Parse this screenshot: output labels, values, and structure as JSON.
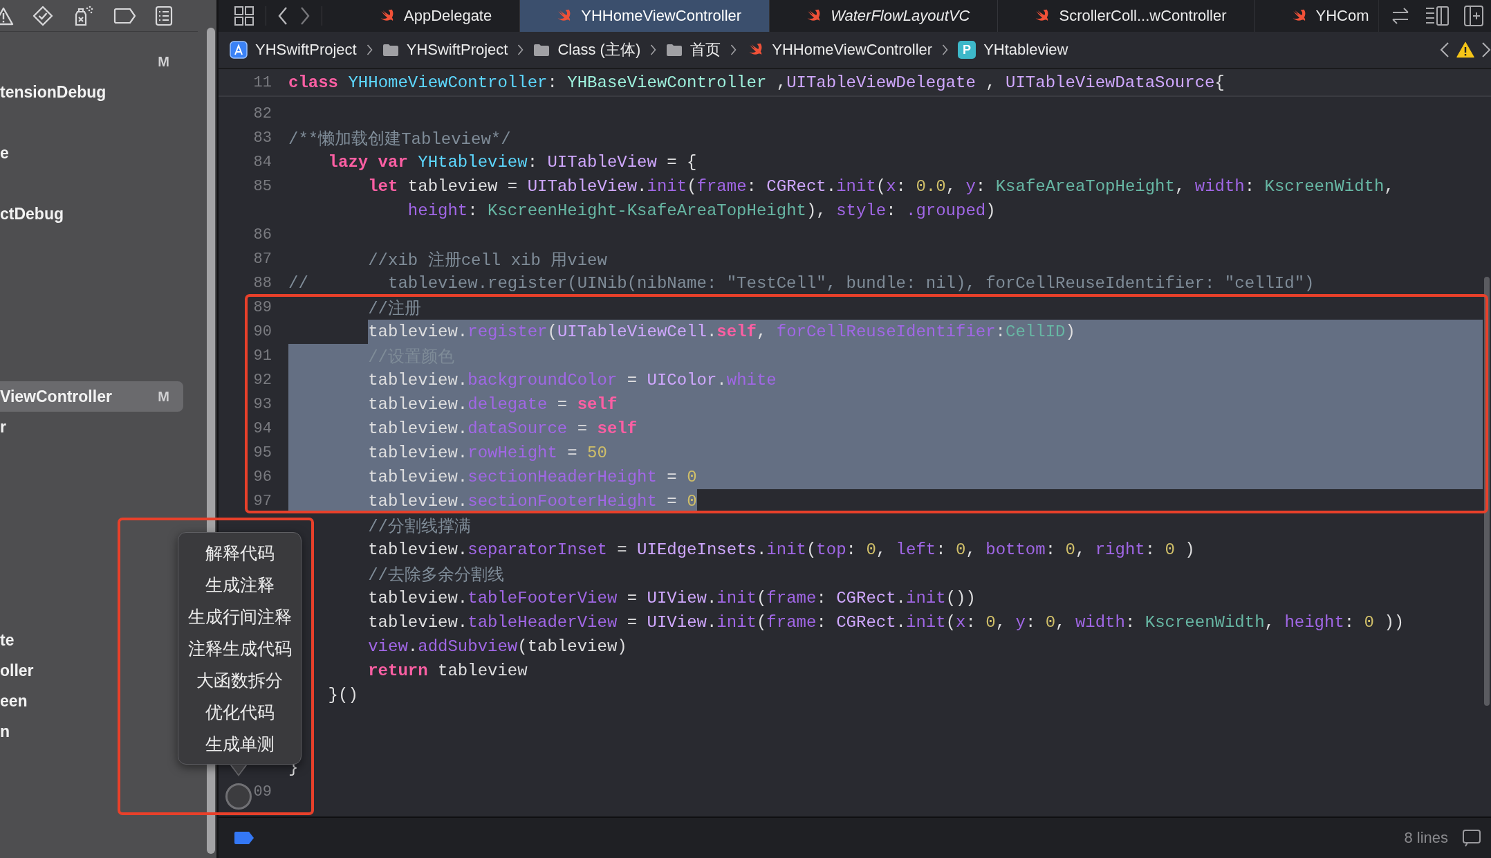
{
  "tabs": [
    {
      "label": "AppDelegate",
      "selected": false,
      "preview": false
    },
    {
      "label": "YHHomeViewController",
      "selected": true,
      "preview": false
    },
    {
      "label": "WaterFlowLayoutVC",
      "selected": false,
      "preview": true
    },
    {
      "label": "ScrollerColl...wController",
      "selected": false,
      "preview": false
    },
    {
      "label": "YHCom",
      "selected": false,
      "preview": false
    }
  ],
  "breadcrumbs": [
    {
      "kind": "project",
      "label": "YHSwiftProject"
    },
    {
      "kind": "folder",
      "label": "YHSwiftProject"
    },
    {
      "kind": "folder",
      "label": "Class (主体)"
    },
    {
      "kind": "folder",
      "label": "首页"
    },
    {
      "kind": "swift",
      "label": "YHHomeViewController"
    },
    {
      "kind": "property",
      "badge": "P",
      "label": "YHtableview"
    }
  ],
  "navigator": {
    "items": [
      {
        "badge": "M",
        "selected": false
      },
      {
        "label": "tensionDebug",
        "selected": false
      },
      {
        "label": "e",
        "selected": false
      },
      {
        "label": "ctDebug",
        "selected": false
      },
      {
        "label": "ViewController",
        "badge": "M",
        "selected": true
      },
      {
        "label": "r",
        "selected": false
      },
      {
        "label": "te",
        "selected": false
      },
      {
        "label": "oller",
        "selected": false
      },
      {
        "label": "een",
        "selected": false
      },
      {
        "label": "n",
        "selected": false
      }
    ]
  },
  "editor": {
    "sticky_line": {
      "number": "11",
      "tokens": [
        {
          "kind": "keyword",
          "text": "class"
        },
        {
          "kind": "decl",
          "text": " YHHomeViewController"
        },
        {
          "kind": "plain",
          "text": ": "
        },
        {
          "kind": "project",
          "text": "YHBaseViewController"
        },
        {
          "kind": "plain",
          "text": " ,"
        },
        {
          "kind": "type",
          "text": "UITableViewDelegate"
        },
        {
          "kind": "plain",
          "text": " , "
        },
        {
          "kind": "type",
          "text": "UITableViewDataSource"
        },
        {
          "kind": "plain",
          "text": "{"
        }
      ]
    },
    "lines": [
      {
        "number": "82",
        "selected": false
      },
      {
        "number": "83",
        "selected": false,
        "rows": [
          {
            "tokens": [
              {
                "kind": "comment",
                "text": "/**懒加载创建Tableview*/"
              }
            ]
          }
        ]
      },
      {
        "number": "84",
        "selected": false,
        "rows": [
          {
            "tokens": [
              {
                "kind": "keyword",
                "text": "    lazy"
              },
              {
                "kind": "keyword",
                "text": " var"
              },
              {
                "kind": "decl",
                "text": " YHtableview"
              },
              {
                "kind": "plain",
                "text": ": "
              },
              {
                "kind": "type",
                "text": "UITableView"
              },
              {
                "kind": "plain",
                "text": " = {"
              }
            ]
          }
        ]
      },
      {
        "number": "85",
        "selected": false,
        "rows": [
          {
            "tokens": [
              {
                "kind": "keyword",
                "text": "        let"
              },
              {
                "kind": "plain",
                "text": " tableview = "
              },
              {
                "kind": "type",
                "text": "UITableView"
              },
              {
                "kind": "plain",
                "text": "."
              },
              {
                "kind": "member",
                "text": "init"
              },
              {
                "kind": "plain",
                "text": "("
              },
              {
                "kind": "member",
                "text": "frame"
              },
              {
                "kind": "plain",
                "text": ": "
              },
              {
                "kind": "type",
                "text": "CGRect"
              },
              {
                "kind": "plain",
                "text": "."
              },
              {
                "kind": "member",
                "text": "init"
              },
              {
                "kind": "plain",
                "text": "("
              },
              {
                "kind": "member",
                "text": "x"
              },
              {
                "kind": "plain",
                "text": ": "
              },
              {
                "kind": "number",
                "text": "0.0"
              },
              {
                "kind": "plain",
                "text": ", "
              },
              {
                "kind": "member",
                "text": "y"
              },
              {
                "kind": "plain",
                "text": ": "
              },
              {
                "kind": "ident",
                "text": "KsafeAreaTopHeight"
              },
              {
                "kind": "plain",
                "text": ", "
              },
              {
                "kind": "member",
                "text": "width"
              },
              {
                "kind": "plain",
                "text": ": "
              },
              {
                "kind": "ident",
                "text": "KscreenWidth"
              },
              {
                "kind": "plain",
                "text": ","
              }
            ]
          },
          {
            "tokens": [
              {
                "kind": "member",
                "text": "            height"
              },
              {
                "kind": "plain",
                "text": ": "
              },
              {
                "kind": "ident",
                "text": "KscreenHeight-KsafeAreaTopHeight"
              },
              {
                "kind": "plain",
                "text": "), "
              },
              {
                "kind": "member",
                "text": "style"
              },
              {
                "kind": "plain",
                "text": ": "
              },
              {
                "kind": "member",
                "text": ".grouped"
              },
              {
                "kind": "plain",
                "text": ")"
              }
            ]
          }
        ]
      },
      {
        "number": "86",
        "selected": false
      },
      {
        "number": "87",
        "selected": false,
        "rows": [
          {
            "tokens": [
              {
                "kind": "comment",
                "text": "        //xib 注册cell xib 用view"
              }
            ]
          }
        ]
      },
      {
        "number": "88",
        "selected": false,
        "rows": [
          {
            "tokens": [
              {
                "kind": "comment",
                "text": "//        tableview.register(UINib(nibName: \"TestCell\", bundle: nil), forCellReuseIdentifier: \"cellId\")"
              }
            ]
          }
        ]
      },
      {
        "number": "89",
        "selected": false,
        "rows": [
          {
            "tokens": [
              {
                "kind": "comment",
                "text": "        //注册"
              }
            ]
          }
        ]
      },
      {
        "number": "90",
        "selected": true,
        "selection_from_text": true,
        "rows": [
          {
            "tokens": [
              {
                "kind": "plain",
                "text": "        tableview."
              },
              {
                "kind": "member",
                "text": "register"
              },
              {
                "kind": "plain",
                "text": "("
              },
              {
                "kind": "type",
                "text": "UITableViewCell"
              },
              {
                "kind": "plain",
                "text": "."
              },
              {
                "kind": "keyword",
                "text": "self"
              },
              {
                "kind": "plain",
                "text": ", "
              },
              {
                "kind": "member",
                "text": "forCellReuseIdentifier"
              },
              {
                "kind": "plain",
                "text": ":"
              },
              {
                "kind": "ident",
                "text": "CellID"
              },
              {
                "kind": "plain",
                "text": ")"
              }
            ]
          }
        ]
      },
      {
        "number": "91",
        "selected": true,
        "rows": [
          {
            "tokens": [
              {
                "kind": "comment",
                "text": "        //设置颜色"
              }
            ]
          }
        ]
      },
      {
        "number": "92",
        "selected": true,
        "rows": [
          {
            "tokens": [
              {
                "kind": "plain",
                "text": "        tableview."
              },
              {
                "kind": "member",
                "text": "backgroundColor"
              },
              {
                "kind": "plain",
                "text": " = "
              },
              {
                "kind": "type",
                "text": "UIColor"
              },
              {
                "kind": "plain",
                "text": "."
              },
              {
                "kind": "member",
                "text": "white"
              }
            ]
          }
        ]
      },
      {
        "number": "93",
        "selected": true,
        "rows": [
          {
            "tokens": [
              {
                "kind": "plain",
                "text": "        tableview."
              },
              {
                "kind": "member",
                "text": "delegate"
              },
              {
                "kind": "plain",
                "text": " = "
              },
              {
                "kind": "keyword",
                "text": "self"
              }
            ]
          }
        ]
      },
      {
        "number": "94",
        "selected": true,
        "rows": [
          {
            "tokens": [
              {
                "kind": "plain",
                "text": "        tableview."
              },
              {
                "kind": "member",
                "text": "dataSource"
              },
              {
                "kind": "plain",
                "text": " = "
              },
              {
                "kind": "keyword",
                "text": "self"
              }
            ]
          }
        ]
      },
      {
        "number": "95",
        "selected": true,
        "rows": [
          {
            "tokens": [
              {
                "kind": "plain",
                "text": "        tableview."
              },
              {
                "kind": "member",
                "text": "rowHeight"
              },
              {
                "kind": "plain",
                "text": " = "
              },
              {
                "kind": "number",
                "text": "50"
              }
            ]
          }
        ]
      },
      {
        "number": "96",
        "selected": true,
        "rows": [
          {
            "tokens": [
              {
                "kind": "plain",
                "text": "        tableview."
              },
              {
                "kind": "member",
                "text": "sectionHeaderHeight"
              },
              {
                "kind": "plain",
                "text": " = "
              },
              {
                "kind": "number",
                "text": "0"
              }
            ]
          }
        ]
      },
      {
        "number": "97",
        "selected": true,
        "selection_to_text": true,
        "rows": [
          {
            "tokens": [
              {
                "kind": "plain",
                "text": "        tableview."
              },
              {
                "kind": "member",
                "text": "sectionFooterHeight"
              },
              {
                "kind": "plain",
                "text": " = "
              },
              {
                "kind": "number",
                "text": "0"
              }
            ]
          }
        ]
      },
      {
        "selected": false,
        "rows": [
          {
            "tokens": [
              {
                "kind": "comment",
                "text": "        //分割线撑满"
              }
            ]
          }
        ]
      },
      {
        "selected": false,
        "rows": [
          {
            "tokens": [
              {
                "kind": "plain",
                "text": "        tableview."
              },
              {
                "kind": "member",
                "text": "separatorInset"
              },
              {
                "kind": "plain",
                "text": " = "
              },
              {
                "kind": "type",
                "text": "UIEdgeInsets"
              },
              {
                "kind": "plain",
                "text": "."
              },
              {
                "kind": "member",
                "text": "init"
              },
              {
                "kind": "plain",
                "text": "("
              },
              {
                "kind": "member",
                "text": "top"
              },
              {
                "kind": "plain",
                "text": ": "
              },
              {
                "kind": "number",
                "text": "0"
              },
              {
                "kind": "plain",
                "text": ", "
              },
              {
                "kind": "member",
                "text": "left"
              },
              {
                "kind": "plain",
                "text": ": "
              },
              {
                "kind": "number",
                "text": "0"
              },
              {
                "kind": "plain",
                "text": ", "
              },
              {
                "kind": "member",
                "text": "bottom"
              },
              {
                "kind": "plain",
                "text": ": "
              },
              {
                "kind": "number",
                "text": "0"
              },
              {
                "kind": "plain",
                "text": ", "
              },
              {
                "kind": "member",
                "text": "right"
              },
              {
                "kind": "plain",
                "text": ": "
              },
              {
                "kind": "number",
                "text": "0"
              },
              {
                "kind": "plain",
                "text": " )"
              }
            ]
          }
        ]
      },
      {
        "selected": false,
        "rows": [
          {
            "tokens": [
              {
                "kind": "comment",
                "text": "        //去除多余分割线"
              }
            ]
          }
        ]
      },
      {
        "selected": false,
        "rows": [
          {
            "tokens": [
              {
                "kind": "plain",
                "text": "        tableview."
              },
              {
                "kind": "member",
                "text": "tableFooterView"
              },
              {
                "kind": "plain",
                "text": " = "
              },
              {
                "kind": "type",
                "text": "UIView"
              },
              {
                "kind": "plain",
                "text": "."
              },
              {
                "kind": "member",
                "text": "init"
              },
              {
                "kind": "plain",
                "text": "("
              },
              {
                "kind": "member",
                "text": "frame"
              },
              {
                "kind": "plain",
                "text": ": "
              },
              {
                "kind": "type",
                "text": "CGRect"
              },
              {
                "kind": "plain",
                "text": "."
              },
              {
                "kind": "member",
                "text": "init"
              },
              {
                "kind": "plain",
                "text": "())"
              }
            ]
          }
        ]
      },
      {
        "selected": false,
        "rows": [
          {
            "tokens": [
              {
                "kind": "plain",
                "text": "        tableview."
              },
              {
                "kind": "member",
                "text": "tableHeaderView"
              },
              {
                "kind": "plain",
                "text": " = "
              },
              {
                "kind": "type",
                "text": "UIView"
              },
              {
                "kind": "plain",
                "text": "."
              },
              {
                "kind": "member",
                "text": "init"
              },
              {
                "kind": "plain",
                "text": "("
              },
              {
                "kind": "member",
                "text": "frame"
              },
              {
                "kind": "plain",
                "text": ": "
              },
              {
                "kind": "type",
                "text": "CGRect"
              },
              {
                "kind": "plain",
                "text": "."
              },
              {
                "kind": "member",
                "text": "init"
              },
              {
                "kind": "plain",
                "text": "("
              },
              {
                "kind": "member",
                "text": "x"
              },
              {
                "kind": "plain",
                "text": ": "
              },
              {
                "kind": "number",
                "text": "0"
              },
              {
                "kind": "plain",
                "text": ", "
              },
              {
                "kind": "member",
                "text": "y"
              },
              {
                "kind": "plain",
                "text": ": "
              },
              {
                "kind": "number",
                "text": "0"
              },
              {
                "kind": "plain",
                "text": ", "
              },
              {
                "kind": "member",
                "text": "width"
              },
              {
                "kind": "plain",
                "text": ": "
              },
              {
                "kind": "ident",
                "text": "KscreenWidth"
              },
              {
                "kind": "plain",
                "text": ", "
              },
              {
                "kind": "member",
                "text": "height"
              },
              {
                "kind": "plain",
                "text": ": "
              },
              {
                "kind": "number",
                "text": "0"
              },
              {
                "kind": "plain",
                "text": " ))"
              }
            ]
          }
        ]
      },
      {
        "selected": false,
        "rows": [
          {
            "tokens": [
              {
                "kind": "member",
                "text": "        view"
              },
              {
                "kind": "plain",
                "text": "."
              },
              {
                "kind": "member",
                "text": "addSubview"
              },
              {
                "kind": "plain",
                "text": "(tableview)"
              }
            ]
          }
        ]
      },
      {
        "selected": false,
        "rows": [
          {
            "tokens": [
              {
                "kind": "keyword",
                "text": "        return"
              },
              {
                "kind": "plain",
                "text": " tableview"
              }
            ]
          }
        ]
      },
      {
        "selected": false,
        "rows": [
          {
            "tokens": [
              {
                "kind": "plain",
                "text": "    }()"
              }
            ]
          }
        ]
      },
      {
        "selected": false
      },
      {
        "selected": false
      },
      {
        "selected": false,
        "rows": [
          {
            "tokens": [
              {
                "kind": "plain",
                "text": "}"
              }
            ]
          }
        ]
      },
      {
        "number": "09",
        "selected": false
      }
    ]
  },
  "popup_menu": {
    "items": [
      "解释代码",
      "生成注释",
      "生成行间注释",
      "注释生成代码",
      "大函数拆分",
      "优化代码",
      "生成单测"
    ]
  },
  "annotations": [
    {
      "kind": "frame",
      "color": "#e8402a"
    },
    {
      "kind": "frame",
      "color": "#e8402a"
    }
  ],
  "status": {
    "text": "8 lines"
  }
}
